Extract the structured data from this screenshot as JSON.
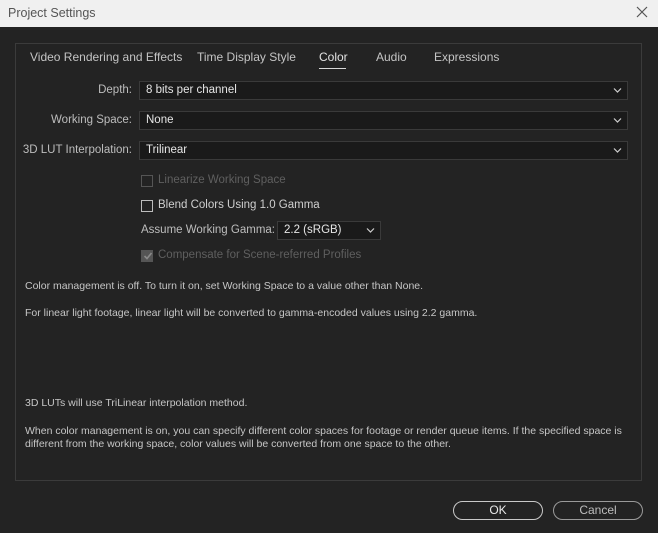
{
  "window": {
    "title": "Project Settings"
  },
  "tabs": [
    {
      "label": "Video Rendering and Effects",
      "active": false
    },
    {
      "label": "Time Display Style",
      "active": false
    },
    {
      "label": "Color",
      "active": true
    },
    {
      "label": "Audio",
      "active": false
    },
    {
      "label": "Expressions",
      "active": false
    }
  ],
  "fields": {
    "depth": {
      "label": "Depth:",
      "value": "8 bits per channel"
    },
    "working_space": {
      "label": "Working Space:",
      "value": "None"
    },
    "lut_interpolation": {
      "label": "3D LUT Interpolation:",
      "value": "Trilinear"
    },
    "assume_gamma": {
      "label": "Assume Working Gamma:",
      "value": "2.2 (sRGB)"
    }
  },
  "checkboxes": {
    "linearize": {
      "label": "Linearize Working Space",
      "checked": false,
      "enabled": false
    },
    "blend": {
      "label": "Blend Colors Using 1.0 Gamma",
      "checked": false,
      "enabled": true
    },
    "compensate": {
      "label": "Compensate for Scene-referred Profiles",
      "checked": true,
      "enabled": false
    }
  },
  "info": {
    "line1": "Color management is off. To turn it on, set Working Space to a value other than None.",
    "line2": "For linear light footage, linear light will be converted to gamma-encoded values using 2.2 gamma.",
    "line3": "3D LUTs will use TriLinear interpolation method.",
    "line4": "When color management is on, you can specify different color spaces for footage or render queue items. If the specified space is different from the working space, color values will be converted from one space to the other."
  },
  "buttons": {
    "ok": "OK",
    "cancel": "Cancel"
  },
  "icons": {
    "close": "close-icon",
    "dropdown": "chevron-down-icon",
    "check": "checkmark-icon"
  },
  "colors": {
    "background": "#232323",
    "titlebar": "#f0f0f0",
    "field": "#1a1a1a",
    "text": "#cfcfcf",
    "disabled_text": "#5f5f5f"
  }
}
